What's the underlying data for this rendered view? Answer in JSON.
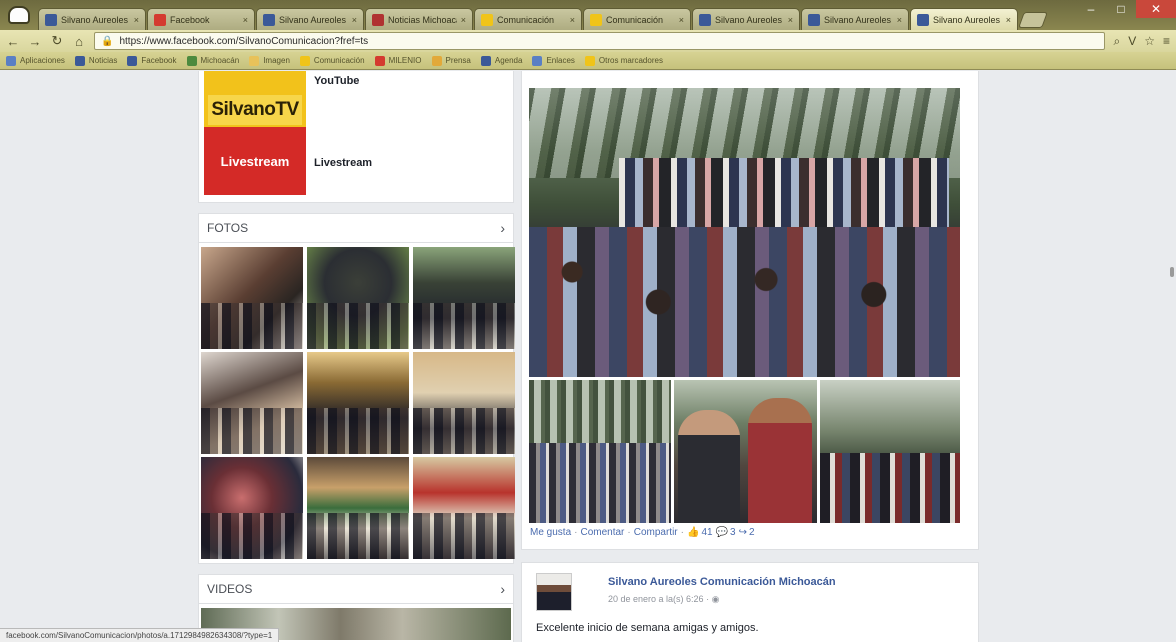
{
  "browser": {
    "tabs": [
      {
        "title": "Silvano Aureoles C",
        "color": "#3b5998",
        "active": false
      },
      {
        "title": "Facebook",
        "color": "#d43a2f",
        "active": false
      },
      {
        "title": "Silvano Aureoles",
        "color": "#3b5998",
        "active": false
      },
      {
        "title": "Noticias Michoacán",
        "color": "#b03131",
        "active": false
      },
      {
        "title": "Comunicación",
        "color": "#f0c419",
        "active": false
      },
      {
        "title": "Comunicación",
        "color": "#f0c419",
        "active": false
      },
      {
        "title": "Silvano Aureoles",
        "color": "#3b5998",
        "active": false
      },
      {
        "title": "Silvano Aureoles",
        "color": "#3b5998",
        "active": false
      },
      {
        "title": "Silvano Aureoles",
        "color": "#3b5998",
        "active": true
      }
    ],
    "url": "https://www.facebook.com/SilvanoComunicacion?fref=ts",
    "bookmarks": [
      {
        "label": "Aplicaciones",
        "color": "#5a7fc4"
      },
      {
        "label": "Noticias",
        "color": "#3b5998"
      },
      {
        "label": "Facebook",
        "color": "#3b5998"
      },
      {
        "label": "Michoacán",
        "color": "#4c8a3e"
      },
      {
        "label": "Imagen",
        "color": "#e8c25a"
      },
      {
        "label": "Comunicación",
        "color": "#f0c419"
      },
      {
        "label": "MILENIO",
        "color": "#d43a2f"
      },
      {
        "label": "Prensa",
        "color": "#e2a93a"
      },
      {
        "label": "Agenda",
        "color": "#3b5998"
      },
      {
        "label": "Enlaces",
        "color": "#5a7fc4"
      },
      {
        "label": "Otros marcadores",
        "color": "#f0c419"
      }
    ]
  },
  "sidebar": {
    "apps": [
      {
        "thumb_text": "SilvanoTV",
        "label": "YouTube"
      },
      {
        "thumb_text": "Livestream",
        "label": "Livestream"
      }
    ],
    "photos_label": "FOTOS",
    "videos_label": "VIDEOS",
    "chevron": "›"
  },
  "feed": {
    "post1": {
      "actions": {
        "like": "Me gusta",
        "comment": "Comentar",
        "share": "Compartir",
        "likes": "41",
        "comments": "3",
        "shares": "2"
      }
    },
    "post2": {
      "author": "Silvano Aureoles Comunicación Michoacán",
      "time": "20 de enero a la(s) 6:26 · ",
      "body": "Excelente inicio de semana amigas y amigos."
    }
  },
  "statusbar": {
    "text": "facebook.com/SilvanoComunicacion/photos/a.1712984982634308/?type=1"
  }
}
